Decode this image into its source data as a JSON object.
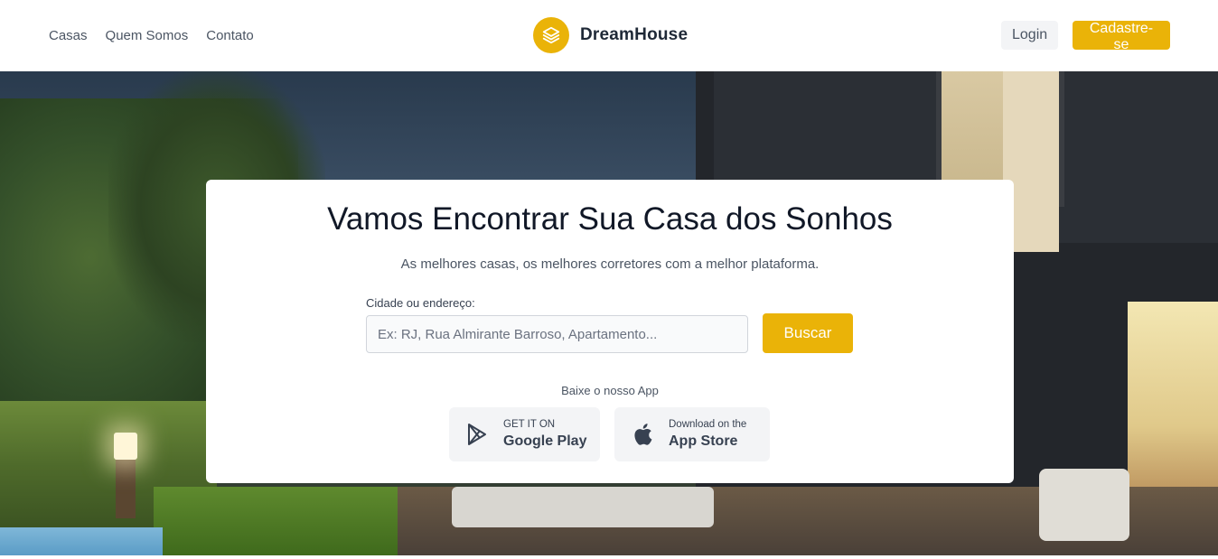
{
  "header": {
    "nav": [
      "Casas",
      "Quem Somos",
      "Contato"
    ],
    "brand": "DreamHouse",
    "login_label": "Login",
    "signup_label": "Cadastre-se"
  },
  "hero": {
    "title": "Vamos Encontrar Sua Casa dos Sonhos",
    "subtitle": "As melhores casas, os melhores corretores com a melhor plataforma.",
    "search": {
      "label": "Cidade ou endereço:",
      "placeholder": "Ex: RJ, Rua Almirante Barroso, Apartamento...",
      "value": "",
      "button_label": "Buscar"
    },
    "app_label": "Baixe o nosso App",
    "stores": [
      {
        "small": "GET IT ON",
        "big": "Google Play",
        "icon": "google-play-icon"
      },
      {
        "small": "Download on the",
        "big": "App Store",
        "icon": "apple-icon"
      }
    ]
  },
  "colors": {
    "accent": "#eab308",
    "text_dark": "#111827",
    "text_muted": "#4b5563",
    "button_light": "#f3f4f6"
  }
}
